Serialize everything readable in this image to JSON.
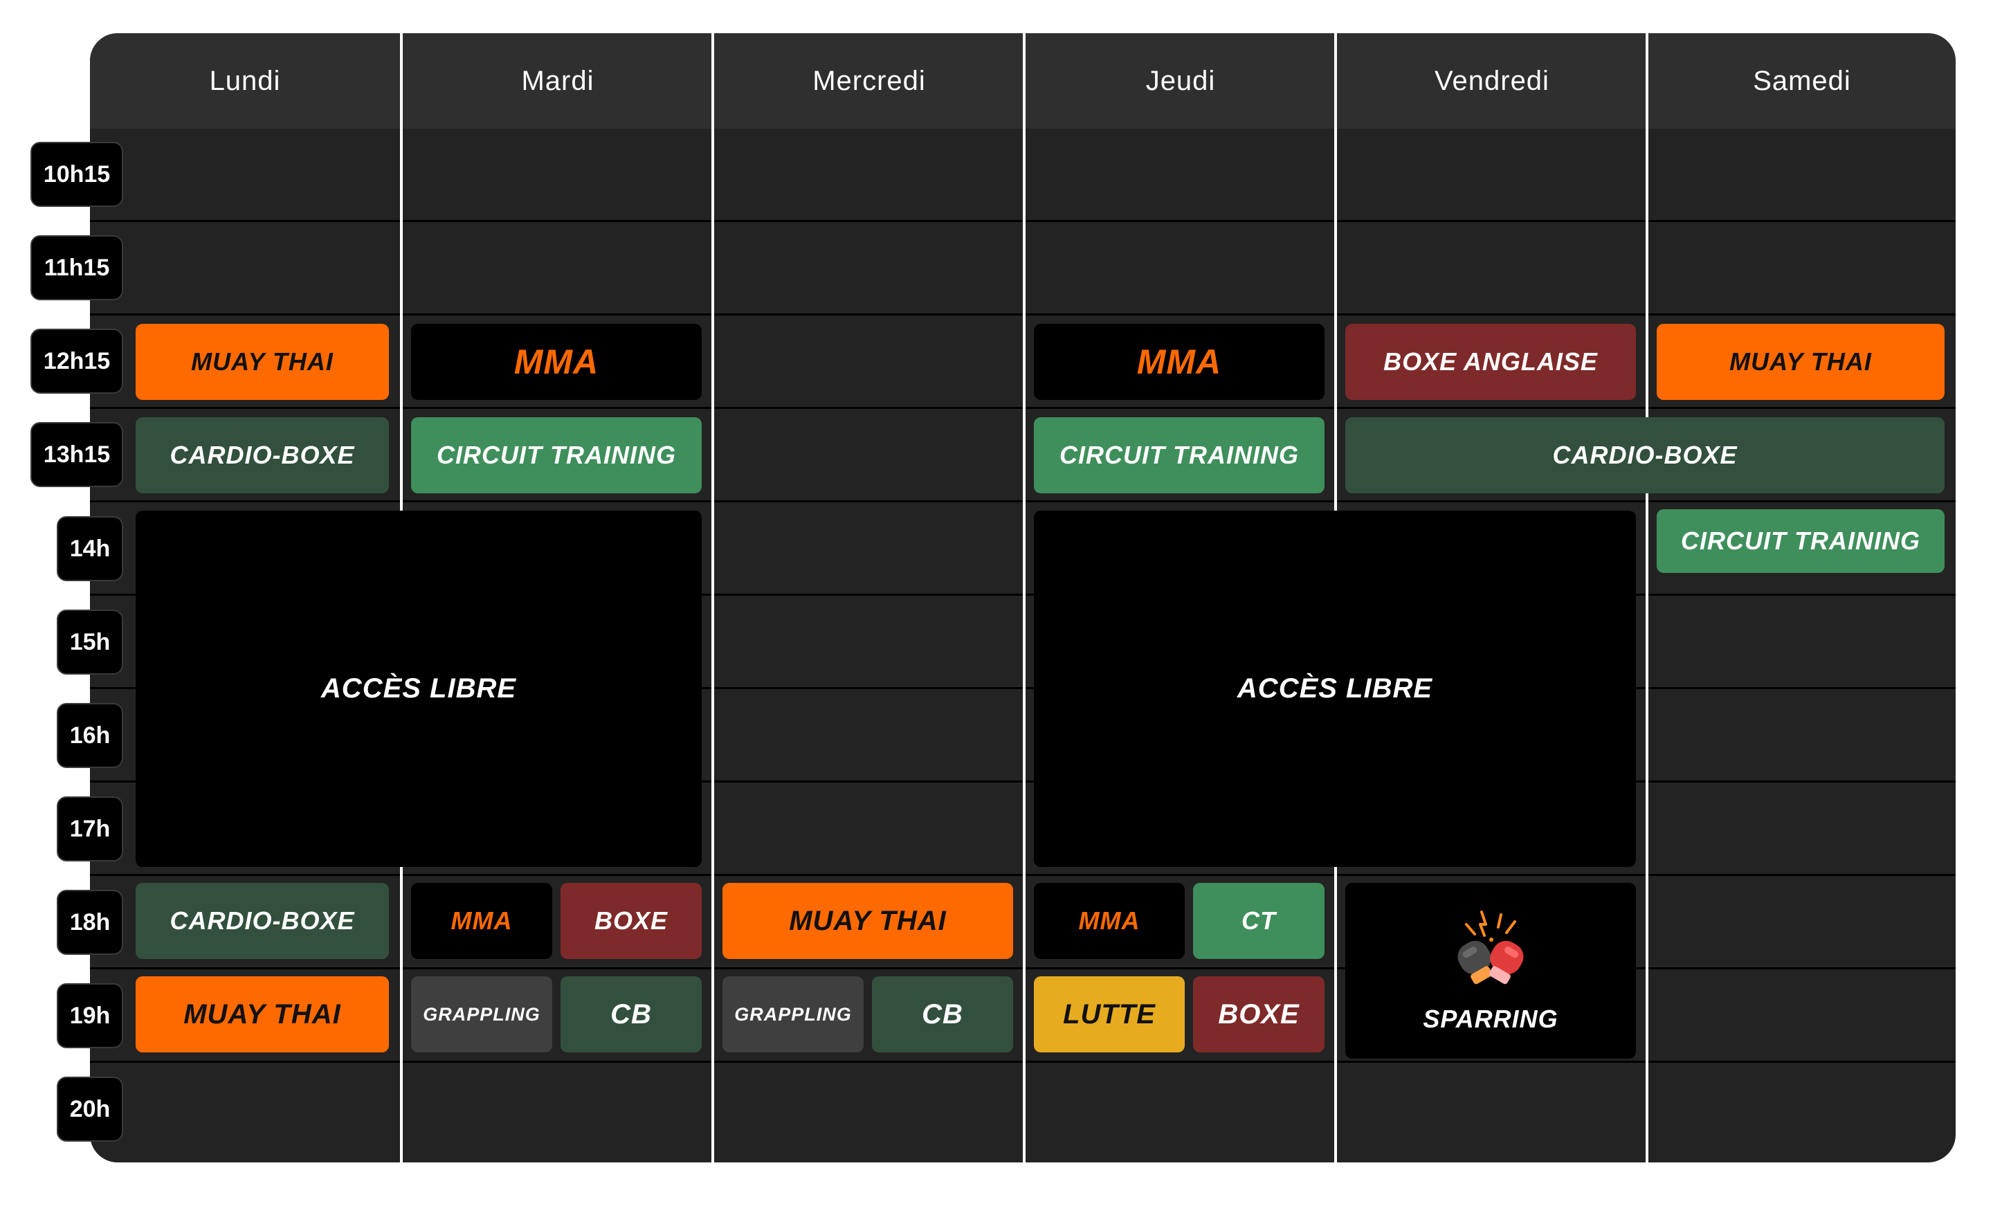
{
  "days": [
    "Lundi",
    "Mardi",
    "Mercredi",
    "Jeudi",
    "Vendredi",
    "Samedi"
  ],
  "times": [
    "10h15",
    "11h15",
    "12h15",
    "13h15",
    "14h",
    "15h",
    "16h",
    "17h",
    "18h",
    "19h",
    "20h"
  ],
  "events": {
    "mon_1215": "MUAY THAI",
    "tue_1215": "MMA",
    "thu_1215": "MMA",
    "fri_1215": "BOXE ANGLAISE",
    "sat_1215": "MUAY THAI",
    "mon_1315": "CARDIO-BOXE",
    "tue_1315": "CIRCUIT TRAINING",
    "thu_1315": "CIRCUIT TRAINING",
    "frisat_1315": "CARDIO-BOXE",
    "sat_14": "CIRCUIT TRAINING",
    "montue_libre": "ACCÈS LIBRE",
    "thufri_libre": "ACCÈS LIBRE",
    "mon_18": "CARDIO-BOXE",
    "tue_18_a": "MMA",
    "tue_18_b": "BOXE",
    "wed_18": "MUAY THAI",
    "thu_18_a": "MMA",
    "thu_18_b": "CT",
    "fri_sparring": "SPARRING",
    "mon_19": "MUAY THAI",
    "tue_19_a": "GRAPPLING",
    "tue_19_b": "CB",
    "wed_19_a": "GRAPPLING",
    "wed_19_b": "CB",
    "thu_19_a": "LUTTE",
    "thu_19_b": "BOXE"
  },
  "icons": {
    "sparring": "boxing-gloves-clash-icon"
  },
  "colors": {
    "orange": "#ff6a00",
    "dark_red": "#7f2a2a",
    "dark_green": "#32503d",
    "green": "#3f8f5c",
    "gray": "#3f3f3f",
    "yellow": "#e6ab1f",
    "black": "#000000",
    "panel": "#232323"
  }
}
